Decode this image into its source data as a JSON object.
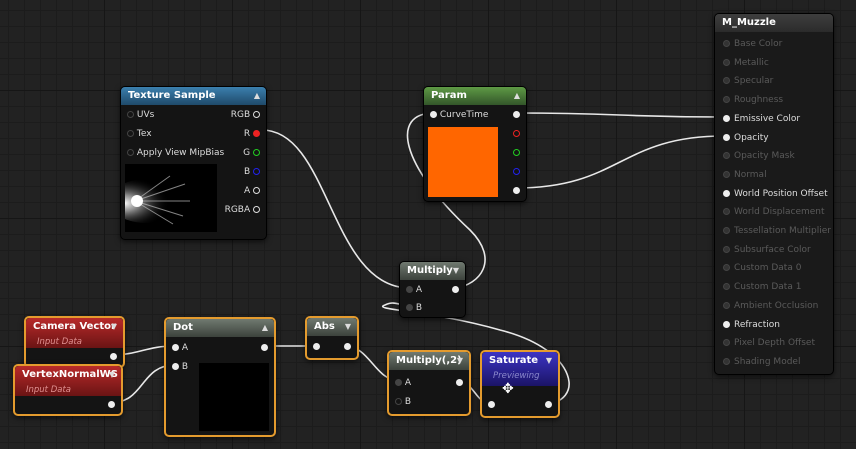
{
  "nodes": {
    "texture_sample": {
      "title": "Texture Sample",
      "inputs": [
        "UVs",
        "Tex",
        "Apply View MipBias"
      ],
      "outputs": [
        "RGB",
        "R",
        "G",
        "B",
        "A",
        "RGBA"
      ]
    },
    "param": {
      "title": "Param",
      "input": "CurveTime",
      "swatch_color": "#ff6600"
    },
    "multiply": {
      "title": "Multiply",
      "inputs": [
        "A",
        "B"
      ]
    },
    "camera_vector": {
      "title": "Camera Vector",
      "subtitle": "Input Data"
    },
    "vertex_normal": {
      "title": "VertexNormalWS",
      "subtitle": "Input Data"
    },
    "dot": {
      "title": "Dot",
      "inputs": [
        "A",
        "B"
      ]
    },
    "abs": {
      "title": "Abs"
    },
    "multiply2": {
      "title": "Multiply(,2)",
      "inputs": [
        "A",
        "B"
      ]
    },
    "saturate": {
      "title": "Saturate",
      "subtitle": "Previewing"
    },
    "material": {
      "title": "M_Muzzle",
      "inputs": [
        {
          "label": "Base Color",
          "active": false
        },
        {
          "label": "Metallic",
          "active": false
        },
        {
          "label": "Specular",
          "active": false
        },
        {
          "label": "Roughness",
          "active": false
        },
        {
          "label": "Emissive Color",
          "active": true
        },
        {
          "label": "Opacity",
          "active": true
        },
        {
          "label": "Opacity Mask",
          "active": false
        },
        {
          "label": "Normal",
          "active": false
        },
        {
          "label": "World Position Offset",
          "active": true
        },
        {
          "label": "World Displacement",
          "active": false
        },
        {
          "label": "Tessellation Multiplier",
          "active": false
        },
        {
          "label": "Subsurface Color",
          "active": false
        },
        {
          "label": "Custom Data 0",
          "active": false
        },
        {
          "label": "Custom Data 1",
          "active": false
        },
        {
          "label": "Ambient Occlusion",
          "active": false
        },
        {
          "label": "Refraction",
          "active": true
        },
        {
          "label": "Pixel Depth Offset",
          "active": false
        },
        {
          "label": "Shading Model",
          "active": false
        }
      ]
    }
  },
  "colors": {
    "selection": "#e49b2e",
    "wire": "#dddddd",
    "orange_swatch": "#ff6600"
  }
}
